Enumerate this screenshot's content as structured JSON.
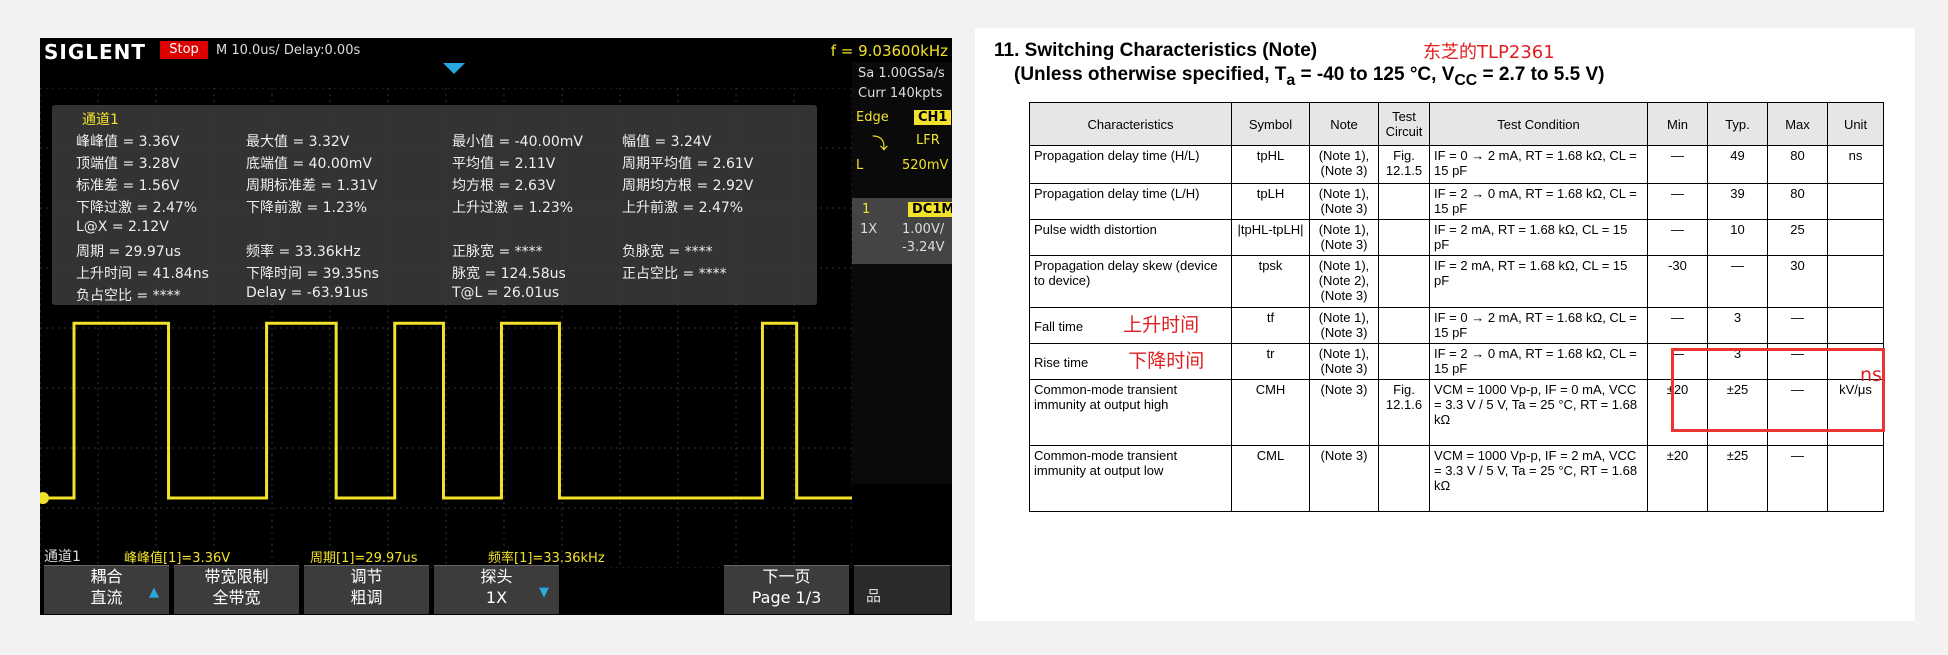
{
  "scope": {
    "brand": "SIGLENT",
    "run_state": "Stop",
    "timebase": "M 10.0us/  Delay:0.00s",
    "frequency": "f = 9.03600kHz",
    "measurement_panel": {
      "title": "通道1",
      "rows": [
        [
          "峰峰值 = 3.36V",
          "最大值 = 3.32V",
          "最小值 = -40.00mV",
          "幅值 = 3.24V"
        ],
        [
          "顶端值 = 3.28V",
          "底端值 = 40.00mV",
          "平均值 = 2.11V",
          "周期平均值 = 2.61V"
        ],
        [
          "标准差 = 1.56V",
          "周期标准差 = 1.31V",
          "均方根 = 2.63V",
          "周期均方根 = 2.92V"
        ],
        [
          "下降过激 = 2.47%",
          "下降前激 = 1.23%",
          "上升过激 = 1.23%",
          "上升前激 = 2.47%"
        ],
        [
          "L@X = 2.12V",
          "",
          "",
          ""
        ],
        [
          "周期 = 29.97us",
          "频率 = 33.36kHz",
          "正脉宽 = ****",
          "负脉宽 = ****"
        ],
        [
          "上升时间 = 41.84ns",
          "下降时间 = 39.35ns",
          "脉宽 = 124.58us",
          "正占空比 = ****"
        ],
        [
          "负占空比 = ****",
          "Delay = -63.91us",
          "T@L = 26.01us",
          ""
        ]
      ]
    },
    "side_panel": {
      "sample_rate": "Sa 1.00GSa/s",
      "memory": "Curr 140kpts",
      "trigger_type": "Edge",
      "trigger_source": "CH1",
      "trigger_slope": "LFR",
      "trigger_level_label": "L",
      "trigger_level": "520mV",
      "channel_number": "1",
      "coupling": "DC1M",
      "probe": "1X",
      "volts_div": "1.00V/",
      "offset": "-3.24V"
    },
    "status_bar": {
      "channel": "通道1",
      "m1": "峰峰值[1]=3.36V",
      "m2": "周期[1]=29.97us",
      "m3": "频率[1]=33.36kHz"
    },
    "softkeys": [
      {
        "line1": "耦合",
        "line2": "直流"
      },
      {
        "line1": "带宽限制",
        "line2": "全带宽"
      },
      {
        "line1": "调节",
        "line2": "粗调"
      },
      {
        "line1": "探头",
        "line2": "1X"
      },
      {
        "line1": "下一页",
        "line2": "Page 1/3"
      }
    ],
    "waveform": {
      "high_level_v": 3.32,
      "low_level_v": -0.04,
      "transitions_us": [
        0.0,
        16.3,
        33.2,
        45.2,
        55.3,
        63.7,
        73.7,
        83.7,
        118.7,
        124.6
      ]
    },
    "colors": {
      "trace": "#f3e22b",
      "accent": "#2aa7e0",
      "stop": "#dd0000"
    }
  },
  "datasheet": {
    "section_title": "11. Switching Characteristics (Note)",
    "subtitle": "(Unless otherwise specified, T",
    "subtitle_sub": "a",
    "subtitle_rest": " = -40 to 125 °C, V",
    "subtitle_sub2": "CC",
    "subtitle_end": " = 2.7 to 5.5 V)",
    "annotation": "东芝的TLP2361",
    "headers": [
      "Characteristics",
      "Symbol",
      "Note",
      "Test Circuit",
      "Test Condition",
      "Min",
      "Typ.",
      "Max",
      "Unit"
    ],
    "rows": [
      {
        "char": "Propagation delay time (H/L)",
        "sym": "tpHL",
        "note": "(Note 1), (Note 3)",
        "circuit": "Fig. 12.1.5",
        "cond": "IF = 0 → 2 mA, RT = 1.68 kΩ, CL = 15 pF",
        "min": "—",
        "typ": "49",
        "max": "80",
        "unit": "ns"
      },
      {
        "char": "Propagation delay time (L/H)",
        "sym": "tpLH",
        "note": "(Note 1), (Note 3)",
        "circuit": "",
        "cond": "IF = 2 → 0 mA, RT = 1.68 kΩ, CL = 15 pF",
        "min": "—",
        "typ": "39",
        "max": "80",
        "unit": ""
      },
      {
        "char": "Pulse width distortion",
        "sym": "|tpHL-tpLH|",
        "note": "(Note 1), (Note 3)",
        "circuit": "",
        "cond": "IF = 2 mA, RT = 1.68 kΩ, CL = 15 pF",
        "min": "—",
        "typ": "10",
        "max": "25",
        "unit": ""
      },
      {
        "char": "Propagation delay skew (device to device)",
        "sym": "tpsk",
        "note": "(Note 1), (Note 2), (Note 3)",
        "circuit": "",
        "cond": "IF = 2 mA, RT = 1.68 kΩ, CL = 15 pF",
        "min": "-30",
        "typ": "—",
        "max": "30",
        "unit": ""
      },
      {
        "char": "Fall time",
        "char_note": "上升时间",
        "sym": "tf",
        "note": "(Note 1), (Note 3)",
        "circuit": "",
        "cond": "IF = 0 → 2 mA, RT = 1.68 kΩ, CL = 15 pF",
        "min": "—",
        "typ": "3",
        "max": "—",
        "unit": ""
      },
      {
        "char": "Rise time",
        "char_note": "下降时间",
        "sym": "tr",
        "note": "(Note 1), (Note 3)",
        "circuit": "",
        "cond": "IF = 2 → 0 mA, RT = 1.68 kΩ, CL = 15 pF",
        "min": "—",
        "typ": "3",
        "max": "—",
        "unit": ""
      },
      {
        "char": "Common-mode transient immunity at output high",
        "sym": "CMH",
        "note": "(Note 3)",
        "circuit": "Fig. 12.1.6",
        "cond": "VCM = 1000 Vp-p, IF = 0 mA, VCC = 3.3 V / 5 V, Ta = 25 °C, RT = 1.68 kΩ",
        "min": "±20",
        "typ": "±25",
        "max": "—",
        "unit": "kV/μs"
      },
      {
        "char": "Common-mode transient immunity at output low",
        "sym": "CML",
        "note": "(Note 3)",
        "circuit": "",
        "cond": "VCM = 1000 Vp-p, IF = 2 mA, VCC = 3.3 V / 5 V, Ta = 25 °C, RT = 1.68 kΩ",
        "min": "±20",
        "typ": "±25",
        "max": "—",
        "unit": ""
      }
    ],
    "highlight_unit": "ns"
  }
}
